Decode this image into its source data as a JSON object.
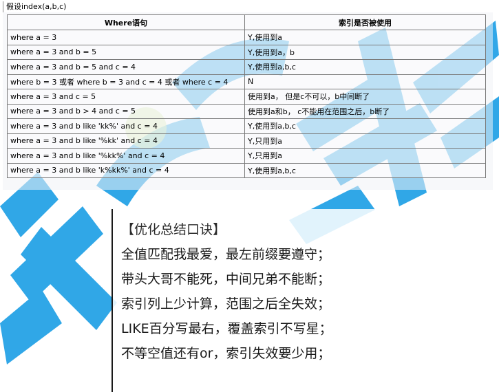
{
  "caption": "假设index(a,b,c)",
  "table": {
    "headers": [
      "Where语句",
      "索引是否被使用"
    ],
    "rows": [
      [
        "where a = 3",
        "Y,使用到a"
      ],
      [
        "where a = 3 and b = 5",
        "Y,使用到a，b"
      ],
      [
        "where a = 3 and b = 5 and c = 4",
        "Y,使用到a,b,c"
      ],
      [
        "where b = 3 或者 where b = 3 and c = 4  或者 where c = 4",
        "N"
      ],
      [
        "where a = 3 and c = 5",
        "使用到a， 但是c不可以，b中间断了"
      ],
      [
        "where a = 3 and b > 4 and c = 5",
        "使用到a和b， c不能用在范围之后，b断了"
      ],
      [
        "where a = 3 and b like 'kk%' and c = 4",
        "Y,使用到a,b,c"
      ],
      [
        "where a = 3 and b like '%kk' and c = 4",
        "Y,只用到a"
      ],
      [
        "where a = 3 and b like '%kk%' and c = 4",
        "Y,只用到a"
      ],
      [
        "where a = 3 and b like 'k%kk%' and c = 4",
        "Y,使用到a,b,c"
      ]
    ]
  },
  "summary": {
    "title": "【优化总结口诀】",
    "lines": [
      "全值匹配我最爱，最左前缀要遵守；",
      "带头大哥不能死，中间兄弟不能断；",
      "索引列上少计算，范围之后全失效；",
      "LIKE百分写最右，覆盖索引不写星；",
      "不等空值还有or，索引失效要少用；"
    ]
  },
  "colors": {
    "watermark_blue": "#1fa0e6",
    "watermark_green": "#c8e38a"
  }
}
